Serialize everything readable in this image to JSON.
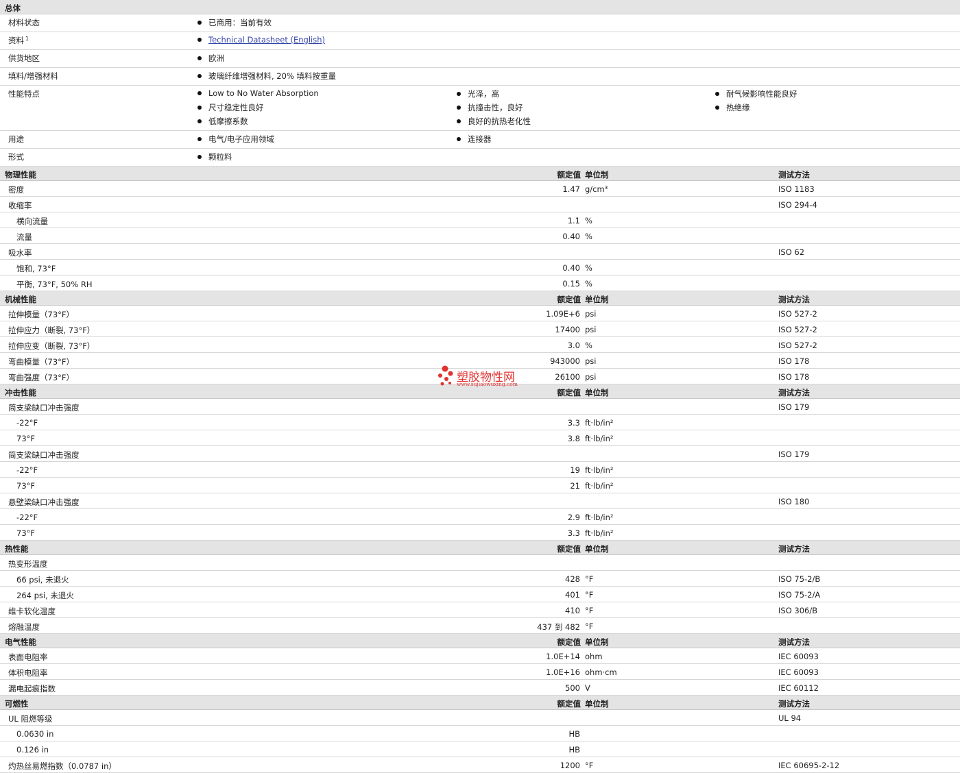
{
  "header_labels": {
    "nominal": "额定值",
    "unit": "单位制",
    "method": "测试方法"
  },
  "general": {
    "title": "总体",
    "rows": [
      {
        "label": "材料状态",
        "items": [
          "已商用：当前有效"
        ]
      },
      {
        "label": "资料",
        "sup": "1",
        "items": [
          "Technical Datasheet (English)"
        ],
        "link": true
      },
      {
        "label": "供货地区",
        "items": [
          "欧洲"
        ]
      },
      {
        "label": "填料/增强材料",
        "items": [
          "玻璃纤维增强材料, 20% 填料按重量"
        ]
      },
      {
        "label": "性能特点",
        "items": [
          "Low to No Water Absorption",
          "尺寸稳定性良好",
          "低摩擦系数",
          "光泽，高",
          "抗撞击性，良好",
          "良好的抗热老化性",
          "耐气候影响性能良好",
          "热绝缘"
        ]
      },
      {
        "label": "用途",
        "items": [
          "电气/电子应用领域",
          "连接器"
        ]
      },
      {
        "label": "形式",
        "items": [
          "颗粒料"
        ]
      }
    ]
  },
  "sections": [
    {
      "title": "物理性能",
      "rows": [
        {
          "label": "密度",
          "level": 1,
          "nominal": "1.47",
          "unit": "g/cm³",
          "method": "ISO 1183"
        },
        {
          "label": "收缩率",
          "level": 1,
          "nominal": "",
          "unit": "",
          "method": "ISO 294-4"
        },
        {
          "label": "横向流量",
          "level": 2,
          "nominal": "1.1",
          "unit": "%",
          "method": ""
        },
        {
          "label": "流量",
          "level": 2,
          "nominal": "0.40",
          "unit": "%",
          "method": ""
        },
        {
          "label": "吸水率",
          "level": 1,
          "nominal": "",
          "unit": "",
          "method": "ISO 62"
        },
        {
          "label": "饱和, 73°F",
          "level": 2,
          "nominal": "0.40",
          "unit": "%",
          "method": ""
        },
        {
          "label": "平衡, 73°F, 50% RH",
          "level": 2,
          "nominal": "0.15",
          "unit": "%",
          "method": ""
        }
      ]
    },
    {
      "title": "机械性能",
      "rows": [
        {
          "label": "拉伸模量（73°F）",
          "level": 1,
          "nominal": "1.09E+6",
          "unit": "psi",
          "method": "ISO 527-2"
        },
        {
          "label": "拉伸应力（断裂, 73°F）",
          "level": 1,
          "nominal": "17400",
          "unit": "psi",
          "method": "ISO 527-2"
        },
        {
          "label": "拉伸应变（断裂, 73°F）",
          "level": 1,
          "nominal": "3.0",
          "unit": "%",
          "method": "ISO 527-2"
        },
        {
          "label": "弯曲模量（73°F）",
          "level": 1,
          "nominal": "943000",
          "unit": "psi",
          "method": "ISO 178"
        },
        {
          "label": "弯曲强度（73°F）",
          "level": 1,
          "nominal": "26100",
          "unit": "psi",
          "method": "ISO 178"
        }
      ]
    },
    {
      "title": "冲击性能",
      "rows": [
        {
          "label": "简支梁缺口冲击强度",
          "level": 1,
          "nominal": "",
          "unit": "",
          "method": "ISO 179"
        },
        {
          "label": "-22°F",
          "level": 2,
          "nominal": "3.3",
          "unit": "ft·lb/in²",
          "method": ""
        },
        {
          "label": "73°F",
          "level": 2,
          "nominal": "3.8",
          "unit": "ft·lb/in²",
          "method": ""
        },
        {
          "label": "简支梁缺口冲击强度",
          "level": 1,
          "nominal": "",
          "unit": "",
          "method": "ISO 179"
        },
        {
          "label": "-22°F",
          "level": 2,
          "nominal": "19",
          "unit": "ft·lb/in²",
          "method": ""
        },
        {
          "label": "73°F",
          "level": 2,
          "nominal": "21",
          "unit": "ft·lb/in²",
          "method": ""
        },
        {
          "label": "悬壁梁缺口冲击强度",
          "level": 1,
          "nominal": "",
          "unit": "",
          "method": "ISO 180"
        },
        {
          "label": "-22°F",
          "level": 2,
          "nominal": "2.9",
          "unit": "ft·lb/in²",
          "method": ""
        },
        {
          "label": "73°F",
          "level": 2,
          "nominal": "3.3",
          "unit": "ft·lb/in²",
          "method": ""
        }
      ]
    },
    {
      "title": "热性能",
      "rows": [
        {
          "label": "热变形温度",
          "level": 1,
          "nominal": "",
          "unit": "",
          "method": ""
        },
        {
          "label": "66 psi, 未退火",
          "level": 2,
          "nominal": "428",
          "unit": "°F",
          "method": "ISO 75-2/B"
        },
        {
          "label": "264 psi, 未退火",
          "level": 2,
          "nominal": "401",
          "unit": "°F",
          "method": "ISO 75-2/A"
        },
        {
          "label": "维卡软化温度",
          "level": 1,
          "nominal": "410",
          "unit": "°F",
          "method": "ISO 306/B"
        },
        {
          "label": "熔融温度",
          "level": 1,
          "nominal": "437 到  482",
          "unit": "°F",
          "method": ""
        }
      ]
    },
    {
      "title": "电气性能",
      "rows": [
        {
          "label": "表面电阻率",
          "level": 1,
          "nominal": "1.0E+14",
          "unit": "ohm",
          "method": "IEC 60093"
        },
        {
          "label": "体积电阻率",
          "level": 1,
          "nominal": "1.0E+16",
          "unit": "ohm·cm",
          "method": "IEC 60093"
        },
        {
          "label": "漏电起痕指数",
          "level": 1,
          "nominal": "500",
          "unit": "V",
          "method": "IEC 60112"
        }
      ]
    },
    {
      "title": "可燃性",
      "rows": [
        {
          "label": "UL 阻燃等级",
          "level": 1,
          "nominal": "",
          "unit": "",
          "method": "UL 94"
        },
        {
          "label": "0.0630 in",
          "level": 2,
          "nominal": "HB",
          "unit": "",
          "method": ""
        },
        {
          "label": "0.126 in",
          "level": 2,
          "nominal": "HB",
          "unit": "",
          "method": ""
        },
        {
          "label": "灼热丝易燃指数（0.0787 in）",
          "level": 1,
          "nominal": "1200",
          "unit": "°F",
          "method": "IEC 60695-2-12"
        }
      ]
    }
  ],
  "watermark": {
    "text": "塑胶物性网",
    "url": "www.sujiaowuxing.com",
    "color": "#e23030"
  }
}
